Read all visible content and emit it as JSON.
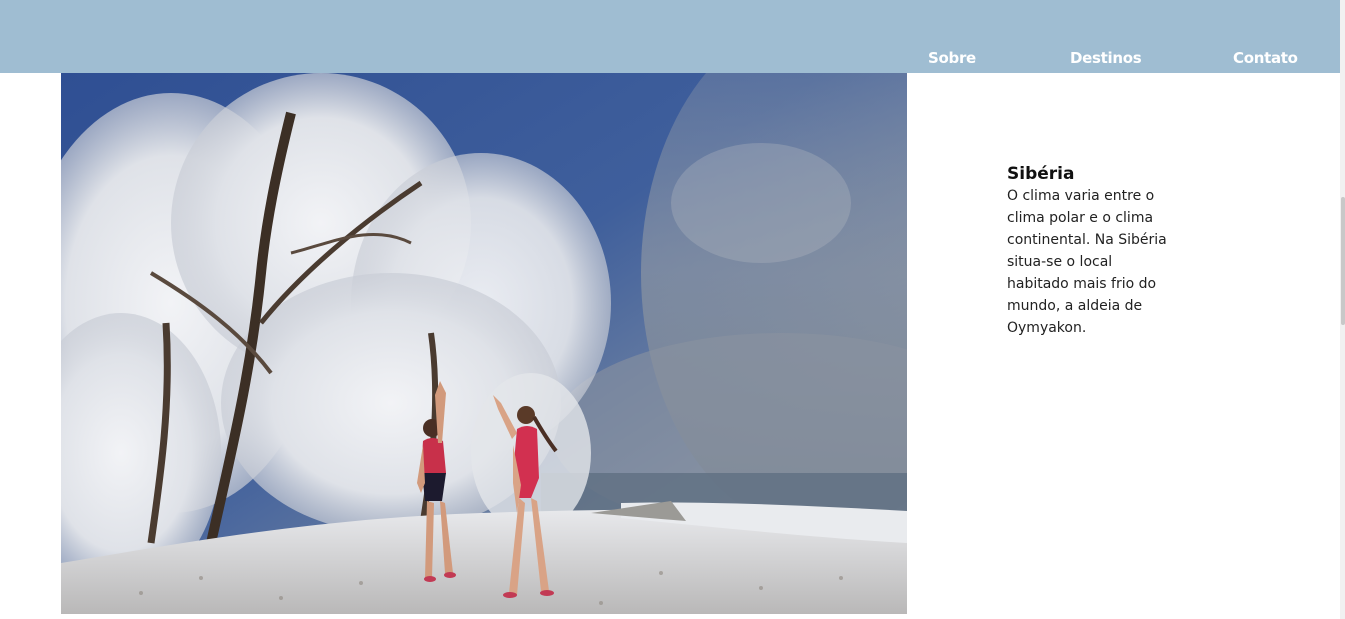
{
  "nav": {
    "items": [
      {
        "label": "Sobre"
      },
      {
        "label": "Destinos"
      },
      {
        "label": "Contato"
      }
    ]
  },
  "destination": {
    "title": "Sibéria",
    "description": "O clima varia entre o clima polar e o clima continental. Na Sibéria situa-se o local habitado mais frio do mundo, a aldeia de Oymyakon."
  },
  "colors": {
    "header_bg": "#9fbdd2",
    "nav_text": "#ffffff"
  },
  "photo": {
    "subject": "two swimmers in red swimsuits on a snowy shore beside frost-covered trees"
  }
}
